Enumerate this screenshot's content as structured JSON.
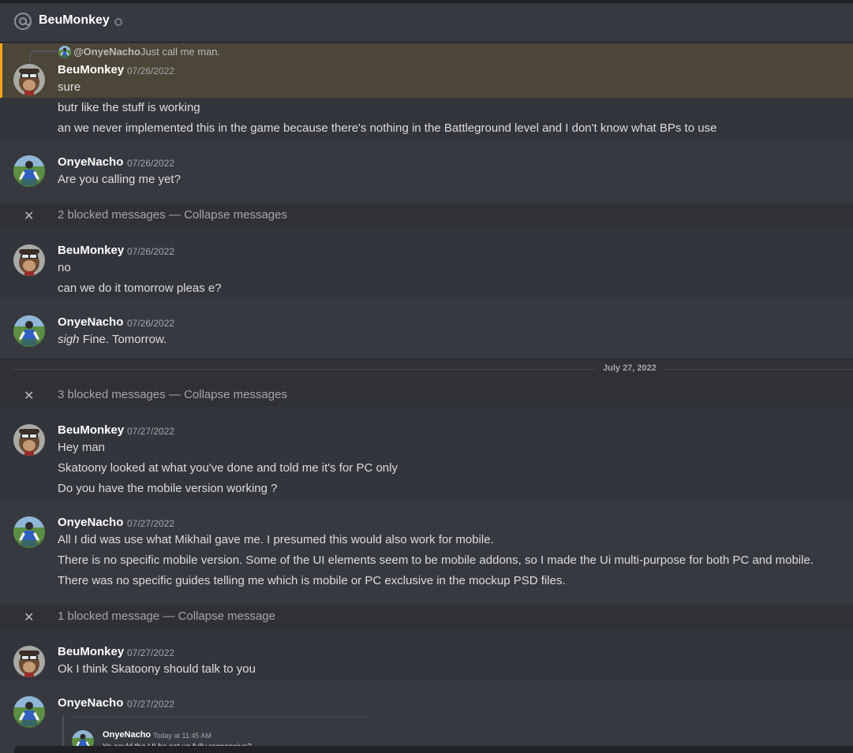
{
  "header": {
    "title": "BeuMonkey",
    "icon": "at-icon",
    "status": "offline"
  },
  "colors": {
    "mention_highlight": "#4b4637",
    "mention_border": "#faa61a"
  },
  "reply": {
    "name": "@OnyeNacho",
    "text": "Just call me man."
  },
  "messages": [
    {
      "author": "BeuMonkey",
      "timestamp": "07/26/2022",
      "lines": [
        "sure",
        "butr like the stuff is working",
        "an we never implemented this in the game because there's nothing in the Battleground level and I don't know what BPs to use"
      ]
    },
    {
      "author": "OnyeNacho",
      "timestamp": "07/26/2022",
      "lines": [
        "Are you calling me yet?"
      ]
    },
    {
      "author": "BeuMonkey",
      "timestamp": "07/26/2022",
      "lines": [
        "no",
        "can we do it tomorrow pleas e?"
      ]
    },
    {
      "author": "OnyeNacho",
      "timestamp": "07/26/2022",
      "lines_italic": "sigh",
      "lines": [
        " Fine. Tomorrow."
      ]
    },
    {
      "author": "BeuMonkey",
      "timestamp": "07/27/2022",
      "lines": [
        "Hey man",
        "Skatoony looked at what you've done and told me it's for PC only",
        "Do you have the mobile version working ?"
      ]
    },
    {
      "author": "OnyeNacho",
      "timestamp": "07/27/2022",
      "lines": [
        "All I did was use what Mikhail gave me. I presumed this would also work for mobile.",
        "There is no specific mobile version. Some of the UI elements seem to be mobile addons, so I made the Ui multi-purpose for both PC and mobile.",
        "There was no specific guides telling me which is mobile or PC exclusive in the mockup PSD files."
      ]
    },
    {
      "author": "BeuMonkey",
      "timestamp": "07/27/2022",
      "lines": [
        "Ok I think Skatoony should talk to you"
      ]
    },
    {
      "author": "OnyeNacho",
      "timestamp": "07/27/2022",
      "lines": []
    }
  ],
  "blocked": [
    {
      "count_text": "2 blocked messages",
      "sep": "—",
      "action": "Collapse messages"
    },
    {
      "count_text": "3 blocked messages",
      "sep": "—",
      "action": "Collapse messages"
    },
    {
      "count_text": "1 blocked message",
      "sep": "—",
      "action": "Collapse message"
    }
  ],
  "divider": {
    "date": "July 27, 2022"
  },
  "embed": {
    "author": "OnyeNacho",
    "timestamp": "Today at 11:45 AM",
    "text": "Yo could the UI be set up fully responsive?"
  }
}
